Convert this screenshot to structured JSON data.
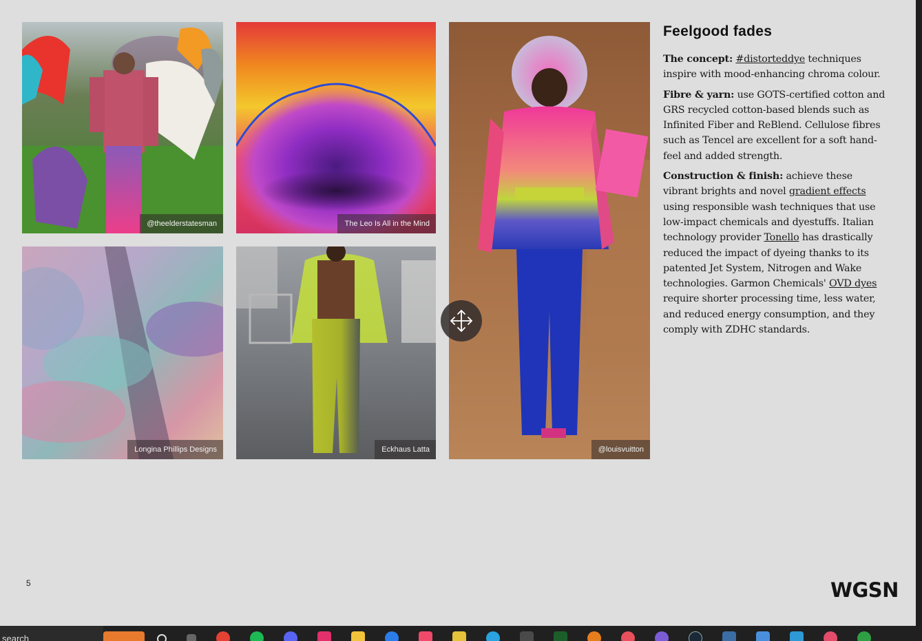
{
  "images": [
    {
      "caption": "@theelderstatesman"
    },
    {
      "caption": "The Leo Is All in the Mind"
    },
    {
      "caption": "@louisvuitton"
    },
    {
      "caption": "Longina Phillips Designs"
    },
    {
      "caption": "Eckhaus Latta"
    }
  ],
  "text": {
    "title": "Feelgood fades",
    "concept": {
      "label": "The concept:",
      "link": "#distorteddye",
      "rest": " techniques inspire with mood-enhancing chroma colour."
    },
    "fibre": {
      "label": "Fibre & yarn:",
      "rest": " use GOTS-certified cotton and GRS recycled cotton-based blends such as Infinited Fiber and ReBlend. Cellulose fibres such as Tencel are excellent for a soft hand-feel and added strength."
    },
    "construction": {
      "label": "Construction & finish:",
      "part1": " achieve these vibrant brights and novel ",
      "link1": "gradient effects",
      "part2": " using responsible wash techniques that use low-impact chemicals and dyestuffs. Italian technology provider ",
      "link2": "Tonello",
      "part3": " has drastically reduced the impact of dyeing thanks to its patented Jet System, Nitrogen and Wake technologies. Garmon Chemicals' ",
      "link3": "OVD dyes",
      "part4": " require shorter processing time, less water, and reduced energy consumption, and they comply with ZDHC standards."
    }
  },
  "footer": {
    "page_number": "5",
    "logo": "WGSN"
  },
  "taskbar": {
    "search_text": "search",
    "icons": [
      "widgets-icon",
      "search-icon",
      "task-view-icon",
      "chrome-icon",
      "spotify-icon",
      "discord-icon",
      "instagram-icon",
      "file-explorer-icon",
      "mail-icon",
      "music-icon",
      "app-icon",
      "telegram-icon",
      "calculator-icon",
      "plant-icon",
      "blender-icon",
      "app-icon-2",
      "app-icon-3",
      "steam-icon",
      "app-icon-4",
      "play-icon",
      "network-icon",
      "record-icon",
      "xbox-icon"
    ]
  }
}
